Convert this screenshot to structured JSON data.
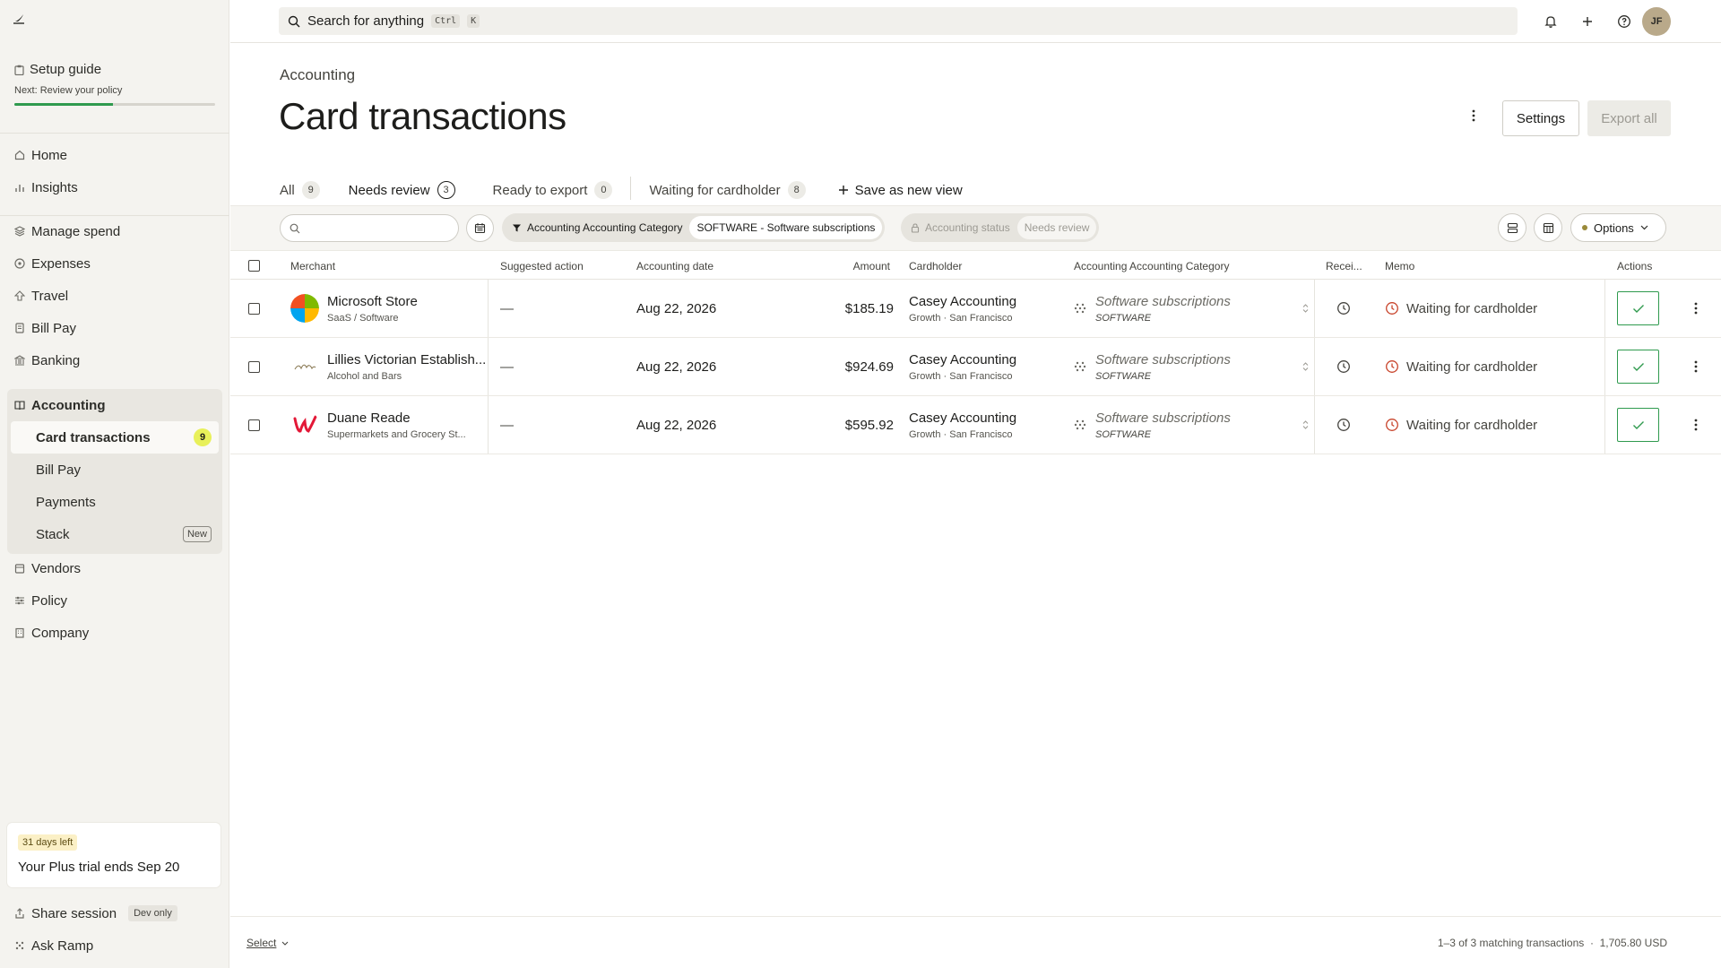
{
  "sidebar": {
    "setup": {
      "title": "Setup guide",
      "subtitle": "Next: Review your policy",
      "progress": 0.49
    },
    "nav_primary": [
      {
        "label": "Home",
        "icon": "home-icon"
      },
      {
        "label": "Insights",
        "icon": "bar-chart-icon"
      }
    ],
    "nav_spend": [
      {
        "label": "Manage spend",
        "icon": "layers-icon"
      },
      {
        "label": "Expenses",
        "icon": "coin-icon"
      },
      {
        "label": "Travel",
        "icon": "plane-icon"
      },
      {
        "label": "Bill Pay",
        "icon": "bill-icon"
      },
      {
        "label": "Banking",
        "icon": "bank-icon"
      }
    ],
    "accounting": {
      "label": "Accounting",
      "items": [
        {
          "label": "Card transactions",
          "badge": "9"
        },
        {
          "label": "Bill Pay"
        },
        {
          "label": "Payments"
        },
        {
          "label": "Stack",
          "tag": "New"
        }
      ]
    },
    "nav_other": [
      {
        "label": "Vendors",
        "icon": "vendor-icon"
      },
      {
        "label": "Policy",
        "icon": "sliders-icon"
      },
      {
        "label": "Company",
        "icon": "building-icon"
      }
    ],
    "trial": {
      "pill": "31 days left",
      "text": "Your Plus trial ends Sep 20"
    },
    "share": {
      "label": "Share session",
      "tag": "Dev only"
    },
    "ask": {
      "label": "Ask Ramp"
    }
  },
  "topbar": {
    "search_label": "Search for anything",
    "kbd1": "Ctrl",
    "kbd2": "K",
    "avatar": "JF"
  },
  "header": {
    "breadcrumb": "Accounting",
    "title": "Card transactions",
    "settings_label": "Settings",
    "export_label": "Export all"
  },
  "tabs": [
    {
      "label": "All",
      "count": "9"
    },
    {
      "label": "Needs review",
      "count": "3"
    },
    {
      "label": "Ready to export",
      "count": "0"
    },
    {
      "label": "Waiting for cardholder",
      "count": "8"
    }
  ],
  "save_view_label": "Save as new view",
  "filters": {
    "search_placeholder": "",
    "category_label": "Accounting Accounting Category",
    "category_value": "SOFTWARE - Software subscriptions",
    "status_label": "Accounting status",
    "status_value": "Needs review",
    "options_label": "Options"
  },
  "columns": {
    "merchant": "Merchant",
    "suggested": "Suggested action",
    "date": "Accounting date",
    "amount": "Amount",
    "cardholder": "Cardholder",
    "category": "Accounting Accounting Category",
    "receipt": "Recei...",
    "memo": "Memo",
    "actions": "Actions"
  },
  "rows": [
    {
      "merchant": "Microsoft Store",
      "merchant_sub": "SaaS / Software",
      "logo": "microsoft-logo",
      "suggested": "—",
      "date": "Aug 22, 2026",
      "amount": "$185.19",
      "cardholder": "Casey Accounting",
      "cardholder_sub": "Growth · San Francisco",
      "category": "Software subscriptions",
      "category_code": "SOFTWARE",
      "memo": "Waiting for cardholder"
    },
    {
      "merchant": "Lillies Victorian Establish...",
      "merchant_sub": "Alcohol and Bars",
      "logo": "lillies-logo",
      "suggested": "—",
      "date": "Aug 22, 2026",
      "amount": "$924.69",
      "cardholder": "Casey Accounting",
      "cardholder_sub": "Growth · San Francisco",
      "category": "Software subscriptions",
      "category_code": "SOFTWARE",
      "memo": "Waiting for cardholder"
    },
    {
      "merchant": "Duane Reade",
      "merchant_sub": "Supermarkets and Grocery St...",
      "logo": "walgreens-logo",
      "suggested": "—",
      "date": "Aug 22, 2026",
      "amount": "$595.92",
      "cardholder": "Casey Accounting",
      "cardholder_sub": "Growth · San Francisco",
      "category": "Software subscriptions",
      "category_code": "SOFTWARE",
      "memo": "Waiting for cardholder"
    }
  ],
  "footer": {
    "select_label": "Select",
    "summary": "1–3 of 3 matching transactions  ·  1,705.80 USD"
  },
  "colors": {
    "accent_green": "#2f9a4e",
    "badge_yellow": "#e8f05a",
    "memo_red": "#c8442b"
  }
}
